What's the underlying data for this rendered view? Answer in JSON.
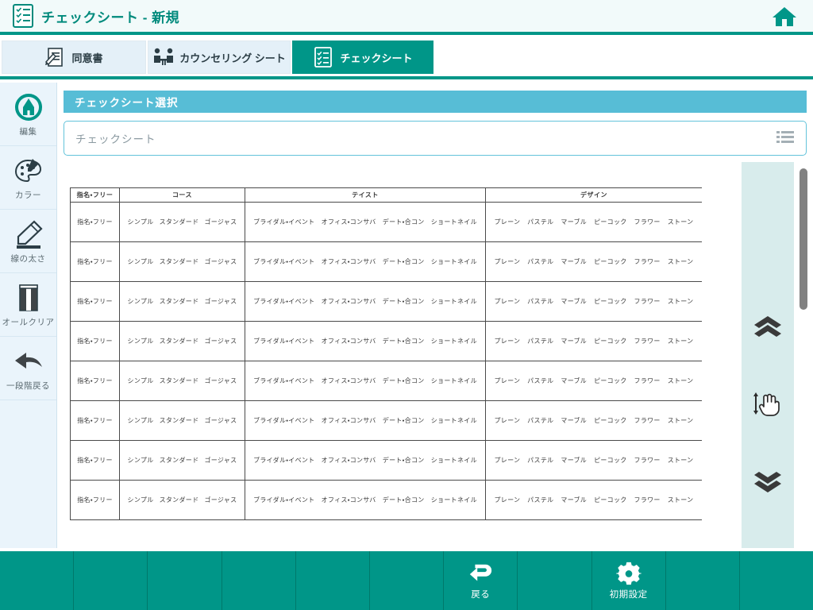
{
  "titlebar": {
    "title": "チェックシート - 新規",
    "icon": "checklist-icon",
    "home_icon": "home-icon",
    "accent_color": "#009688",
    "background_color": "#f2fafa"
  },
  "tabs": [
    {
      "label": "同意書",
      "icon": "consent-document-icon",
      "active": false
    },
    {
      "label": "カウンセリング シート",
      "icon": "counseling-people-icon",
      "active": false
    },
    {
      "label": "チェックシート",
      "icon": "checklist-icon",
      "active": true
    }
  ],
  "sidebar": {
    "items": [
      {
        "label": "編集",
        "icon": "pen-circle-icon"
      },
      {
        "label": "カラー",
        "icon": "palette-icon"
      },
      {
        "label": "線の太さ",
        "icon": "pencil-thickness-icon"
      },
      {
        "label": "オールクリア",
        "icon": "eraser-icon"
      },
      {
        "label": "一段階戻る",
        "icon": "undo-arrow-icon"
      }
    ],
    "background_color": "#eaf4fb"
  },
  "main": {
    "section_title": "チェックシート選択",
    "section_header_color": "#57bdd6",
    "select_field": {
      "value": "",
      "placeholder": "チェックシート",
      "list_icon": "list-icon"
    }
  },
  "scroll_rail": {
    "background_color": "#d8ecec",
    "buttons": [
      {
        "name": "scroll-up-button",
        "icon": "double-chevron-up-icon"
      },
      {
        "name": "drag-scroll-handle",
        "icon": "drag-hand-icon"
      },
      {
        "name": "scroll-down-button",
        "icon": "double-chevron-down-icon"
      }
    ],
    "scrollbar": {
      "thumb_color": "#818181"
    }
  },
  "table": {
    "columns": [
      {
        "header": "指名・フリー",
        "options": [
          "指名・フリー"
        ]
      },
      {
        "header": "コース",
        "options": [
          "シンプル",
          "スタンダード",
          "ゴージャス"
        ]
      },
      {
        "header": "テイスト",
        "options": [
          "ブライダル・イベント",
          "オフィス・コンサバ",
          "デート・合コン",
          "ショートネイル"
        ]
      },
      {
        "header": "デザイン",
        "options": [
          "プレーン",
          "パステル",
          "マーブル",
          "ピーコック",
          "フラワー",
          "ストーン"
        ]
      }
    ],
    "row_count": 8
  },
  "bottombar": {
    "background_color": "#009688",
    "cells": [
      {
        "label": "",
        "icon": ""
      },
      {
        "label": "",
        "icon": ""
      },
      {
        "label": "",
        "icon": ""
      },
      {
        "label": "",
        "icon": ""
      },
      {
        "label": "",
        "icon": ""
      },
      {
        "label": "",
        "icon": ""
      },
      {
        "label": "戻る",
        "icon": "back-arrow-icon"
      },
      {
        "label": "",
        "icon": ""
      },
      {
        "label": "初期設定",
        "icon": "gear-icon"
      },
      {
        "label": "",
        "icon": ""
      },
      {
        "label": "",
        "icon": ""
      }
    ]
  }
}
